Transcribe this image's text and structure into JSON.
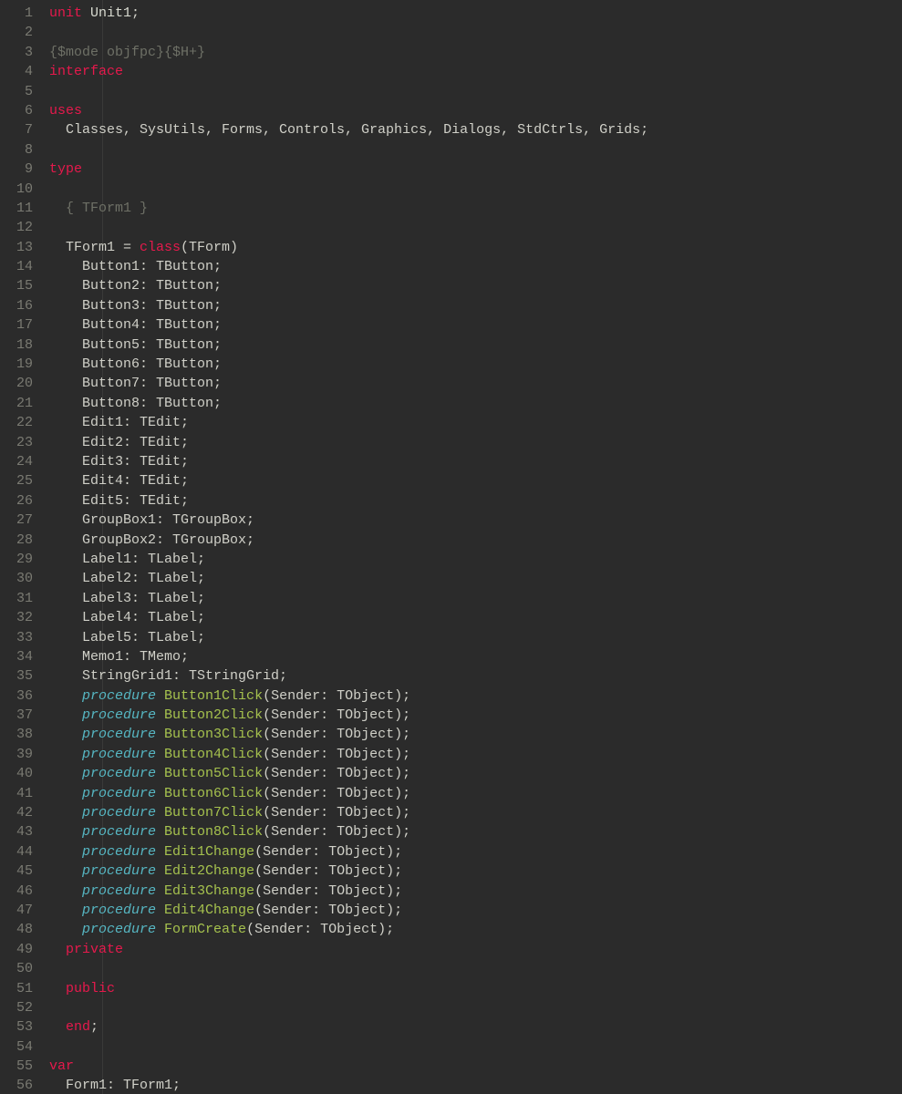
{
  "language": "Object Pascal (Free Pascal / Lazarus)",
  "lines": [
    {
      "n": 1,
      "tokens": [
        {
          "c": "kw",
          "t": "unit"
        },
        {
          "c": "ident",
          "t": " "
        },
        {
          "c": "unit",
          "t": "Unit1"
        },
        {
          "c": "ident",
          "t": ";"
        }
      ]
    },
    {
      "n": 2,
      "tokens": []
    },
    {
      "n": 3,
      "tokens": [
        {
          "c": "comment",
          "t": "{$mode objfpc}{$H+}"
        }
      ]
    },
    {
      "n": 4,
      "tokens": [
        {
          "c": "kw",
          "t": "interface"
        }
      ]
    },
    {
      "n": 5,
      "tokens": []
    },
    {
      "n": 6,
      "tokens": [
        {
          "c": "kw",
          "t": "uses"
        }
      ]
    },
    {
      "n": 7,
      "tokens": [
        {
          "c": "ident",
          "t": "  Classes, SysUtils, Forms, Controls, Graphics, Dialogs, StdCtrls, Grids;"
        }
      ]
    },
    {
      "n": 8,
      "tokens": []
    },
    {
      "n": 9,
      "tokens": [
        {
          "c": "kw",
          "t": "type"
        }
      ]
    },
    {
      "n": 10,
      "tokens": []
    },
    {
      "n": 11,
      "tokens": [
        {
          "c": "ident",
          "t": "  "
        },
        {
          "c": "comment",
          "t": "{ TForm1 }"
        }
      ]
    },
    {
      "n": 12,
      "tokens": []
    },
    {
      "n": 13,
      "tokens": [
        {
          "c": "ident",
          "t": "  TForm1 = "
        },
        {
          "c": "kw",
          "t": "class"
        },
        {
          "c": "ident",
          "t": "(TForm)"
        }
      ]
    },
    {
      "n": 14,
      "tokens": [
        {
          "c": "ident",
          "t": "    Button1: TButton;"
        }
      ]
    },
    {
      "n": 15,
      "tokens": [
        {
          "c": "ident",
          "t": "    Button2: TButton;"
        }
      ]
    },
    {
      "n": 16,
      "tokens": [
        {
          "c": "ident",
          "t": "    Button3: TButton;"
        }
      ]
    },
    {
      "n": 17,
      "tokens": [
        {
          "c": "ident",
          "t": "    Button4: TButton;"
        }
      ]
    },
    {
      "n": 18,
      "tokens": [
        {
          "c": "ident",
          "t": "    Button5: TButton;"
        }
      ]
    },
    {
      "n": 19,
      "tokens": [
        {
          "c": "ident",
          "t": "    Button6: TButton;"
        }
      ]
    },
    {
      "n": 20,
      "tokens": [
        {
          "c": "ident",
          "t": "    Button7: TButton;"
        }
      ]
    },
    {
      "n": 21,
      "tokens": [
        {
          "c": "ident",
          "t": "    Button8: TButton;"
        }
      ]
    },
    {
      "n": 22,
      "tokens": [
        {
          "c": "ident",
          "t": "    Edit1: TEdit;"
        }
      ]
    },
    {
      "n": 23,
      "tokens": [
        {
          "c": "ident",
          "t": "    Edit2: TEdit;"
        }
      ]
    },
    {
      "n": 24,
      "tokens": [
        {
          "c": "ident",
          "t": "    Edit3: TEdit;"
        }
      ]
    },
    {
      "n": 25,
      "tokens": [
        {
          "c": "ident",
          "t": "    Edit4: TEdit;"
        }
      ]
    },
    {
      "n": 26,
      "tokens": [
        {
          "c": "ident",
          "t": "    Edit5: TEdit;"
        }
      ]
    },
    {
      "n": 27,
      "tokens": [
        {
          "c": "ident",
          "t": "    GroupBox1: TGroupBox;"
        }
      ]
    },
    {
      "n": 28,
      "tokens": [
        {
          "c": "ident",
          "t": "    GroupBox2: TGroupBox;"
        }
      ]
    },
    {
      "n": 29,
      "tokens": [
        {
          "c": "ident",
          "t": "    Label1: TLabel;"
        }
      ]
    },
    {
      "n": 30,
      "tokens": [
        {
          "c": "ident",
          "t": "    Label2: TLabel;"
        }
      ]
    },
    {
      "n": 31,
      "tokens": [
        {
          "c": "ident",
          "t": "    Label3: TLabel;"
        }
      ]
    },
    {
      "n": 32,
      "tokens": [
        {
          "c": "ident",
          "t": "    Label4: TLabel;"
        }
      ]
    },
    {
      "n": 33,
      "tokens": [
        {
          "c": "ident",
          "t": "    Label5: TLabel;"
        }
      ]
    },
    {
      "n": 34,
      "tokens": [
        {
          "c": "ident",
          "t": "    Memo1: TMemo;"
        }
      ]
    },
    {
      "n": 35,
      "tokens": [
        {
          "c": "ident",
          "t": "    StringGrid1: TStringGrid;"
        }
      ]
    },
    {
      "n": 36,
      "tokens": [
        {
          "c": "ident",
          "t": "    "
        },
        {
          "c": "kwit",
          "t": "procedure"
        },
        {
          "c": "ident",
          "t": " "
        },
        {
          "c": "call",
          "t": "Button1Click"
        },
        {
          "c": "ident",
          "t": "(Sender: TObject);"
        }
      ]
    },
    {
      "n": 37,
      "tokens": [
        {
          "c": "ident",
          "t": "    "
        },
        {
          "c": "kwit",
          "t": "procedure"
        },
        {
          "c": "ident",
          "t": " "
        },
        {
          "c": "call",
          "t": "Button2Click"
        },
        {
          "c": "ident",
          "t": "(Sender: TObject);"
        }
      ]
    },
    {
      "n": 38,
      "tokens": [
        {
          "c": "ident",
          "t": "    "
        },
        {
          "c": "kwit",
          "t": "procedure"
        },
        {
          "c": "ident",
          "t": " "
        },
        {
          "c": "call",
          "t": "Button3Click"
        },
        {
          "c": "ident",
          "t": "(Sender: TObject);"
        }
      ]
    },
    {
      "n": 39,
      "tokens": [
        {
          "c": "ident",
          "t": "    "
        },
        {
          "c": "kwit",
          "t": "procedure"
        },
        {
          "c": "ident",
          "t": " "
        },
        {
          "c": "call",
          "t": "Button4Click"
        },
        {
          "c": "ident",
          "t": "(Sender: TObject);"
        }
      ]
    },
    {
      "n": 40,
      "tokens": [
        {
          "c": "ident",
          "t": "    "
        },
        {
          "c": "kwit",
          "t": "procedure"
        },
        {
          "c": "ident",
          "t": " "
        },
        {
          "c": "call",
          "t": "Button5Click"
        },
        {
          "c": "ident",
          "t": "(Sender: TObject);"
        }
      ]
    },
    {
      "n": 41,
      "tokens": [
        {
          "c": "ident",
          "t": "    "
        },
        {
          "c": "kwit",
          "t": "procedure"
        },
        {
          "c": "ident",
          "t": " "
        },
        {
          "c": "call",
          "t": "Button6Click"
        },
        {
          "c": "ident",
          "t": "(Sender: TObject);"
        }
      ]
    },
    {
      "n": 42,
      "tokens": [
        {
          "c": "ident",
          "t": "    "
        },
        {
          "c": "kwit",
          "t": "procedure"
        },
        {
          "c": "ident",
          "t": " "
        },
        {
          "c": "call",
          "t": "Button7Click"
        },
        {
          "c": "ident",
          "t": "(Sender: TObject);"
        }
      ]
    },
    {
      "n": 43,
      "tokens": [
        {
          "c": "ident",
          "t": "    "
        },
        {
          "c": "kwit",
          "t": "procedure"
        },
        {
          "c": "ident",
          "t": " "
        },
        {
          "c": "call",
          "t": "Button8Click"
        },
        {
          "c": "ident",
          "t": "(Sender: TObject);"
        }
      ]
    },
    {
      "n": 44,
      "tokens": [
        {
          "c": "ident",
          "t": "    "
        },
        {
          "c": "kwit",
          "t": "procedure"
        },
        {
          "c": "ident",
          "t": " "
        },
        {
          "c": "call",
          "t": "Edit1Change"
        },
        {
          "c": "ident",
          "t": "(Sender: TObject);"
        }
      ]
    },
    {
      "n": 45,
      "tokens": [
        {
          "c": "ident",
          "t": "    "
        },
        {
          "c": "kwit",
          "t": "procedure"
        },
        {
          "c": "ident",
          "t": " "
        },
        {
          "c": "call",
          "t": "Edit2Change"
        },
        {
          "c": "ident",
          "t": "(Sender: TObject);"
        }
      ]
    },
    {
      "n": 46,
      "tokens": [
        {
          "c": "ident",
          "t": "    "
        },
        {
          "c": "kwit",
          "t": "procedure"
        },
        {
          "c": "ident",
          "t": " "
        },
        {
          "c": "call",
          "t": "Edit3Change"
        },
        {
          "c": "ident",
          "t": "(Sender: TObject);"
        }
      ]
    },
    {
      "n": 47,
      "tokens": [
        {
          "c": "ident",
          "t": "    "
        },
        {
          "c": "kwit",
          "t": "procedure"
        },
        {
          "c": "ident",
          "t": " "
        },
        {
          "c": "call",
          "t": "Edit4Change"
        },
        {
          "c": "ident",
          "t": "(Sender: TObject);"
        }
      ]
    },
    {
      "n": 48,
      "tokens": [
        {
          "c": "ident",
          "t": "    "
        },
        {
          "c": "kwit",
          "t": "procedure"
        },
        {
          "c": "ident",
          "t": " "
        },
        {
          "c": "call",
          "t": "FormCreate"
        },
        {
          "c": "ident",
          "t": "(Sender: TObject);"
        }
      ]
    },
    {
      "n": 49,
      "tokens": [
        {
          "c": "ident",
          "t": "  "
        },
        {
          "c": "kw",
          "t": "private"
        }
      ]
    },
    {
      "n": 50,
      "tokens": []
    },
    {
      "n": 51,
      "tokens": [
        {
          "c": "ident",
          "t": "  "
        },
        {
          "c": "kw",
          "t": "public"
        }
      ]
    },
    {
      "n": 52,
      "tokens": []
    },
    {
      "n": 53,
      "tokens": [
        {
          "c": "ident",
          "t": "  "
        },
        {
          "c": "kw",
          "t": "end"
        },
        {
          "c": "ident",
          "t": ";"
        }
      ]
    },
    {
      "n": 54,
      "tokens": []
    },
    {
      "n": 55,
      "tokens": [
        {
          "c": "kw",
          "t": "var"
        }
      ]
    },
    {
      "n": 56,
      "tokens": [
        {
          "c": "ident",
          "t": "  Form1: TForm1;"
        }
      ]
    }
  ]
}
